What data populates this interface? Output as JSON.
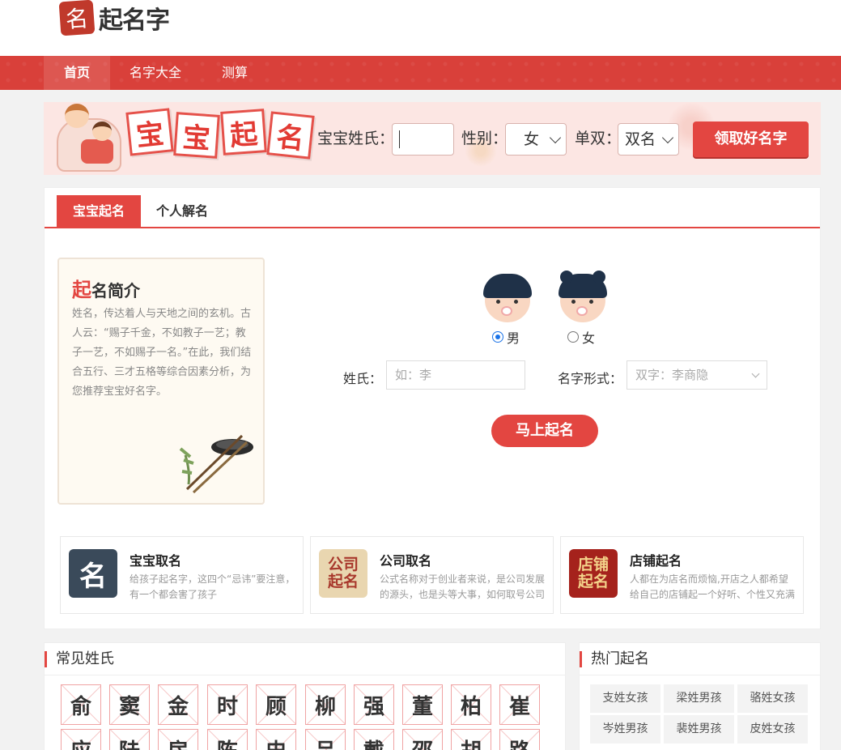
{
  "header": {
    "logo_mark": "名",
    "logo_text": "起名字"
  },
  "nav": {
    "items": [
      "首页",
      "名字大全",
      "测算"
    ]
  },
  "banner": {
    "tiles": [
      "宝",
      "宝",
      "起",
      "名"
    ],
    "surname_label": "宝宝姓氏：",
    "surname_value": "",
    "gender_label": "性别：",
    "gender_value": "女",
    "single_double_label": "单双：",
    "single_double_value": "双名",
    "cta": "领取好名字"
  },
  "tabs": [
    "宝宝起名",
    "个人解名"
  ],
  "intro": {
    "title_accent": "起",
    "title_rest": "名简介",
    "text": "姓名，传达着人与天地之间的玄机。古人云：“赐子千金，不如教子一艺；教子一艺，不如赐子一名。”在此，我们结合五行、三才五格等综合因素分析，为您推荐宝宝好名字。"
  },
  "form": {
    "gender_male": "男",
    "gender_female": "女",
    "gender_selected": "男",
    "surname_label": "姓氏：",
    "surname_placeholder": "如：李",
    "format_label": "名字形式：",
    "format_value": "双字：李商隐",
    "submit": "马上起名"
  },
  "cards": [
    {
      "icon_text": "名",
      "title": "宝宝取名",
      "desc": "给孩子起名字，这四个“忌讳”要注意，有一个都会害了孩子"
    },
    {
      "icon_text": "公司\n起名",
      "title": "公司取名",
      "desc": "公式名称对于创业者来说，是公司发展的源头，也是头等大事，如何取号公司名称"
    },
    {
      "icon_text": "店铺\n起名",
      "title": "店铺起名",
      "desc": "人都在为店名而烦恼,开店之人都希望给自己的店铺起一个好听、个性又充满意义的名字"
    }
  ],
  "surnames": {
    "title": "常见姓氏",
    "row1": [
      "俞",
      "窦",
      "金",
      "时",
      "顾",
      "柳",
      "强",
      "董",
      "柏",
      "崔"
    ],
    "row2": [
      "应",
      "陆",
      "房",
      "陈",
      "史",
      "吕",
      "戴",
      "邵",
      "胡",
      "路"
    ]
  },
  "hot": {
    "title": "热门起名",
    "items": [
      "支姓女孩",
      "梁姓男孩",
      "骆姓女孩",
      "岑姓男孩",
      "裴姓男孩",
      "皮姓女孩"
    ]
  },
  "colors": {
    "brand_red": "#e34641",
    "nav_red": "#d9403a"
  }
}
